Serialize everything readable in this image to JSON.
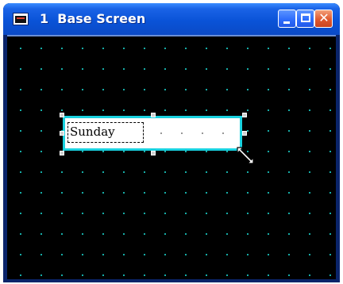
{
  "window": {
    "title": "1  Base Screen",
    "title_icon": "app-screen-icon",
    "controls": {
      "minimize_icon": "minimize-icon",
      "maximize_icon": "maximize-icon",
      "close_icon": "close-icon",
      "close_glyph": "✕"
    }
  },
  "canvas": {
    "background": "#000000",
    "grid_dot_color": "#19c7c0",
    "selected_object": {
      "text": "Sunday",
      "border_color": "#19d2e0"
    }
  },
  "cursor": "resize-diagonal-icon"
}
